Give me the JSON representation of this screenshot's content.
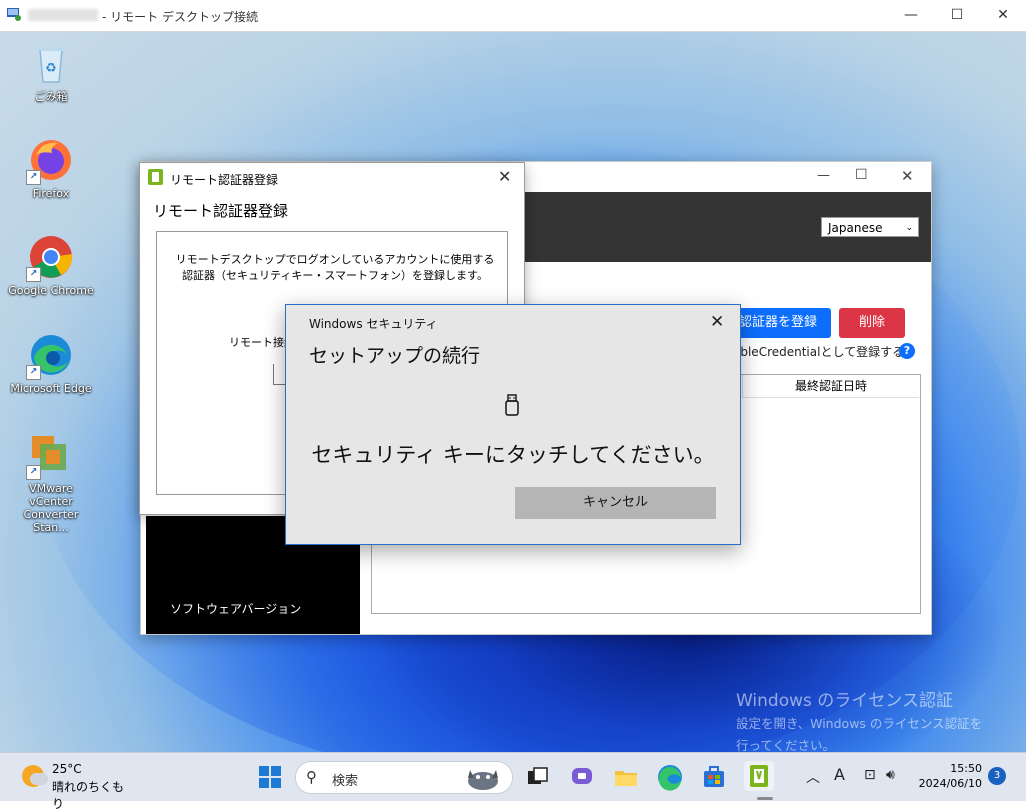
{
  "rdp": {
    "title_suffix": "- リモート デスクトップ接続",
    "minimize": "—",
    "maximize": "☐",
    "close": "✕"
  },
  "desktop_icons": [
    {
      "label": "ごみ箱",
      "icon": "recycle-bin-icon"
    },
    {
      "label": "Firefox",
      "icon": "firefox-icon"
    },
    {
      "label": "Google Chrome",
      "icon": "chrome-icon"
    },
    {
      "label": "Microsoft Edge",
      "icon": "edge-icon"
    },
    {
      "label": "VMware vCenter Converter Stan...",
      "icon": "vmware-icon"
    }
  ],
  "app": {
    "language": "Japanese",
    "register_btn": "認証器を登録",
    "delete_btn": "削除",
    "cred_note": "ableCredentialとして登録する。",
    "help": "?",
    "table_col": "最終認証日時",
    "version_label": "ソフトウェアバージョン",
    "win_min": "—",
    "win_max": "☐",
    "win_close": "✕"
  },
  "reg_dialog": {
    "caption": "リモート認証器登録",
    "heading": "リモート認証器登録",
    "desc": "リモートデスクトップでログオンしているアカウントに使用する認証器（セキュリティキー・スマートフォン）を登録します。",
    "remote_label": "リモート接続",
    "close": "✕"
  },
  "security": {
    "caption": "Windows セキュリティ",
    "title": "セットアップの続行",
    "message": "セキュリティ キーにタッチしてください。",
    "cancel": "キャンセル",
    "close": "✕"
  },
  "watermark": {
    "title": "Windows のライセンス認証",
    "line1": "設定を開き、Windows のライセンス認証を",
    "line2": "行ってください。"
  },
  "taskbar": {
    "temp": "25°C",
    "condition": "晴れのちくもり",
    "search_placeholder": "検索",
    "time": "15:50",
    "date": "2024/06/10",
    "notifications": "3",
    "ime": "A"
  },
  "colors": {
    "accent_blue": "#0d6efd",
    "danger_red": "#dc3545",
    "dialog_border": "#2b6cc4"
  }
}
